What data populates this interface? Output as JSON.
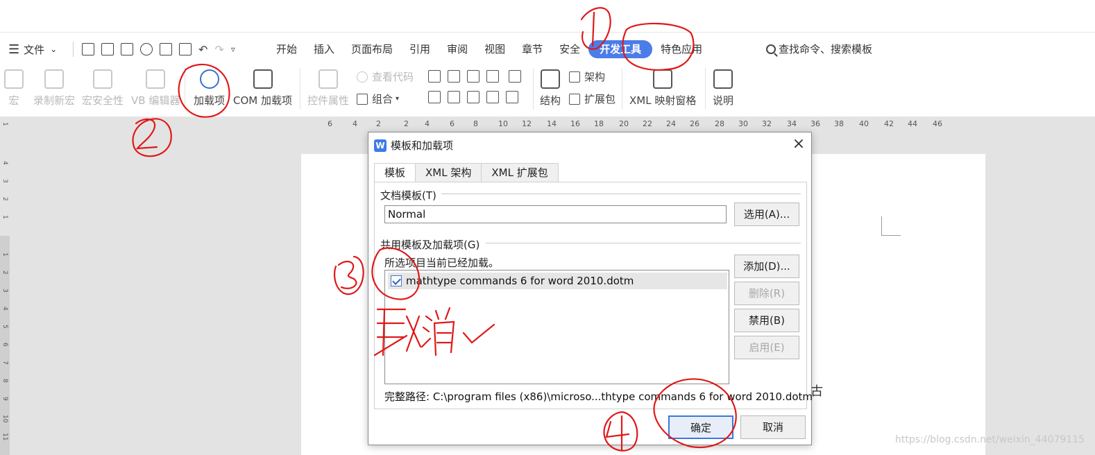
{
  "menubar": {
    "file_menu": "文件",
    "tabs": [
      "开始",
      "插入",
      "页面布局",
      "引用",
      "审阅",
      "视图",
      "章节",
      "安全",
      "开发工具",
      "特色应用"
    ],
    "active_tab": "开发工具",
    "search_command": "查找命令、搜索模板"
  },
  "ribbon": {
    "macro": "宏",
    "record_macro": "录制新宏",
    "macro_security": "宏安全性",
    "vb_editor": "VB 编辑器",
    "addins": "加载项",
    "com_addins": "COM 加载项",
    "control_props": "控件属性",
    "view_code": "查看代码",
    "group": "组合",
    "structure": "结构",
    "schema": "架构",
    "expansion_pack": "扩展包",
    "xml_mapping_pane": "XML 映射窗格",
    "help": "说明"
  },
  "ruler": {
    "ticks": [
      "6",
      "4",
      "2",
      "2",
      "4",
      "6",
      "8",
      "10",
      "12",
      "14",
      "16",
      "18",
      "20",
      "22",
      "24",
      "26",
      "28",
      "30",
      "32",
      "34",
      "36",
      "38",
      "40",
      "42",
      "44",
      "46"
    ]
  },
  "vruler": {
    "ticks": [
      "1",
      "4",
      "3",
      "2",
      "1",
      "1",
      "2",
      "3",
      "4",
      "5",
      "6",
      "7",
      "8",
      "9",
      "10",
      "11"
    ]
  },
  "page": {
    "partial_char": "古"
  },
  "dialog": {
    "title": "模板和加载项",
    "tabs": [
      "模板",
      "XML 架构",
      "XML 扩展包"
    ],
    "doc_template_label": "文档模板(T)",
    "doc_template_value": "Normal",
    "select_button": "选用(A)...",
    "shared_label": "共用模板及加载项(G)",
    "loaded_note": "所选项目当前已经加载。",
    "items": [
      {
        "name": "mathtype commands 6 for word 2010.dotm",
        "checked": true
      }
    ],
    "add_button": "添加(D)...",
    "remove_button": "删除(R)",
    "disable_button": "禁用(B)",
    "enable_button": "启用(E)",
    "full_path": "完整路径: C:\\program files (x86)\\microso...thtype commands 6 for word 2010.dotm",
    "ok_button": "确定",
    "cancel_button": "取消"
  },
  "annotations": {
    "handwritten_note": "取消"
  },
  "watermark": "https://blog.csdn.net/weixin_44079115"
}
